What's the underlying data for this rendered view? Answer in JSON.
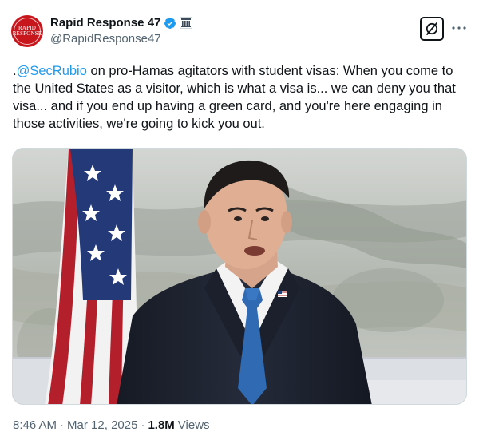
{
  "author": {
    "avatar_text_line1": "RAPID",
    "avatar_text_line2": "RESPONSE",
    "display_name": "Rapid Response 47",
    "handle": "@RapidResponse47"
  },
  "tweet": {
    "text_prefix": ".",
    "mention": "@SecRubio",
    "text_body": " on pro-Hamas agitators with student visas: When you come to the United States as a visitor, which is what a visa is... we can deny you that visa... and if you end up having a green card, and you're here engaging in those activities, we're going to kick you out."
  },
  "meta": {
    "time": "8:46 AM",
    "separator1": "·",
    "date": "Mar 12, 2025",
    "separator2": "·",
    "views_count": "1.8M",
    "views_label": "Views"
  },
  "icons": {
    "verified": "verified-badge-icon",
    "affiliation": "government-building-icon",
    "grok": "grok-slash-icon",
    "more": "more-dots-icon"
  },
  "colors": {
    "link": "#1d9bf0",
    "verified": "#1d9bf0",
    "avatar": "#c8161d",
    "secondary_text": "#536471"
  }
}
